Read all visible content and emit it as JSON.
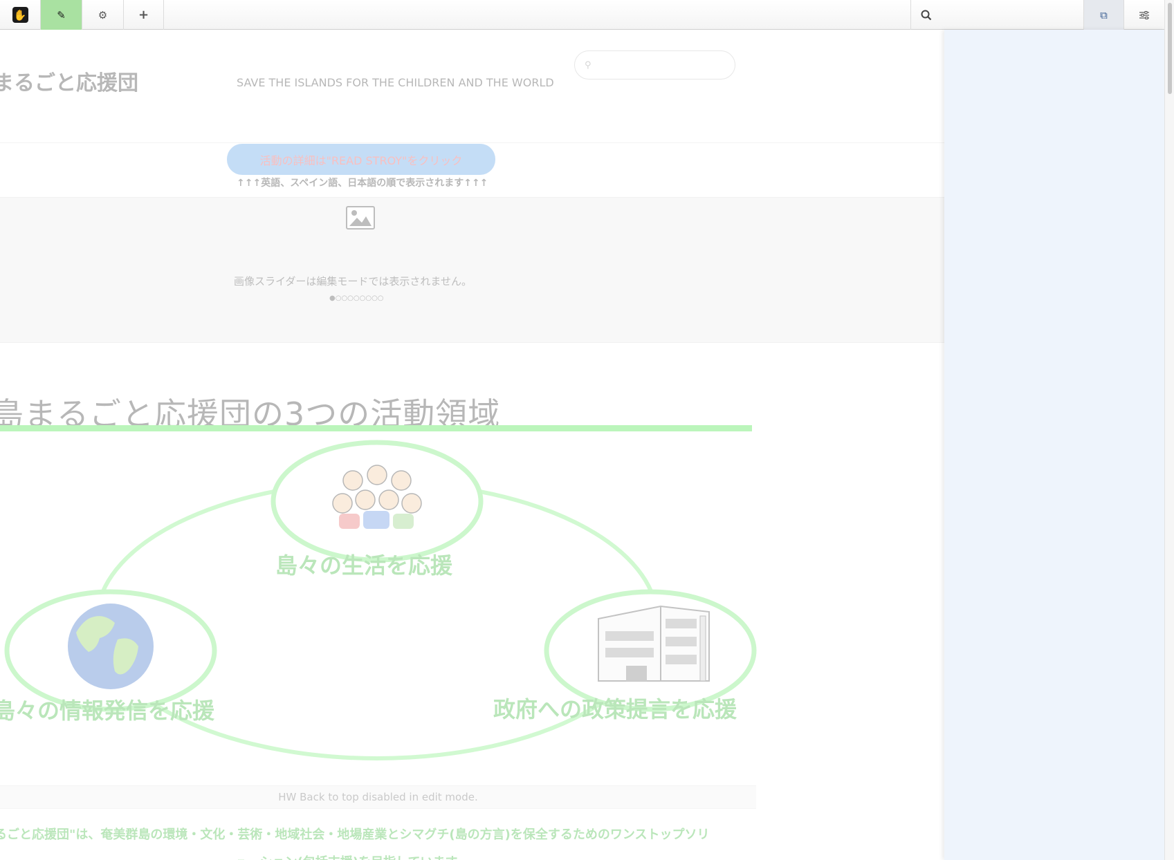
{
  "toolbar": {
    "logo_glyph": "✋",
    "edit_glyph": "✎",
    "settings_glyph": "⚙",
    "add_glyph": "+",
    "search_glyph": "⌕",
    "right1_glyph": "⧉",
    "right2_glyph": "⚟"
  },
  "site": {
    "title": "まるごと応援団",
    "tagline": "SAVE THE ISLANDS FOR THE CHILDREN AND THE WORLD",
    "search_glyph": "⚲"
  },
  "cta": {
    "label": "活動の詳細は\"READ STROY\"をクリック",
    "note": "↑↑↑英語、スペイン語、日本語の順で表示されます↑↑↑"
  },
  "slider": {
    "message": "画像スライダーは編集モードでは表示されません。",
    "dots": "●○○○○○○○○"
  },
  "activities": {
    "heading": "島まるごと応援団の3つの活動領域",
    "items": [
      {
        "label": "島々の生活を応援",
        "icon": "people-icon"
      },
      {
        "label": "島々の情報発信を応援",
        "icon": "globe-icon"
      },
      {
        "label": "政府への政策提言を応援",
        "icon": "building-icon"
      }
    ]
  },
  "backtop": {
    "message": "HW Back to top disabled in edit mode."
  },
  "footer": {
    "line1": "るごと応援団\"は、奄美群島の環境・文化・芸術・地域社会・地場産業とシマグチ(島の方言)を保全するためのワンストップソリ",
    "line2": "ューション(包括支援)を目指しています。"
  },
  "colors": {
    "accent_green": "#3fe33f",
    "edit_active": "#a9e1a1",
    "panel_bg": "#eef4fc",
    "cta_bg": "#5aa0e8",
    "cta_text": "#f04a4a"
  }
}
